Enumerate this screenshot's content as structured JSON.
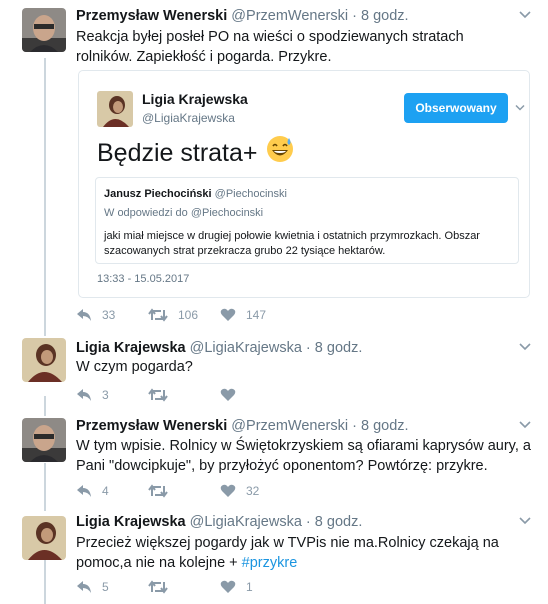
{
  "tweets": [
    {
      "name": "Przemysław Wenerski",
      "handle": "@PrzemWenerski",
      "separator": "·",
      "time": "8 godz.",
      "text": "Reakcja byłej posłeł PO na wieści o spodziewanych stratach rolników. Zapiekłość i pogarda. Przykre.",
      "reply_count": "33",
      "retweet_count": "106",
      "like_count": "147"
    },
    {
      "name": "Ligia Krajewska",
      "handle": "@LigiaKrajewska",
      "separator": "·",
      "time": "8 godz.",
      "text": "W czym pogarda?",
      "reply_count": "3",
      "retweet_count": "",
      "like_count": ""
    },
    {
      "name": "Przemysław Wenerski",
      "handle": "@PrzemWenerski",
      "separator": "·",
      "time": "8 godz.",
      "text": "W tym wpisie. Rolnicy w Świętokrzyskiem są ofiarami kaprysów aury, a Pani \"dowcipkuje\", by przyłożyć oponentom? Powtórzę: przykre.",
      "reply_count": "4",
      "retweet_count": "",
      "like_count": "32"
    },
    {
      "name": "Ligia Krajewska",
      "handle": "@LigiaKrajewska",
      "separator": "·",
      "time": "8 godz.",
      "text": "Przecież większej pogardy jak w TVPis nie ma.Rolnicy czekają na pomoc,a nie na kolejne + ",
      "hashtag": "#przykre",
      "reply_count": "5",
      "retweet_count": "",
      "like_count": "1"
    }
  ],
  "quoted": {
    "name": "Ligia Krajewska",
    "handle": "@LigiaKrajewska",
    "follow_label": "Obserwowany",
    "text": "Będzie strata+",
    "emoji": "😅",
    "time": "13:33 - 15.05.2017",
    "inner": {
      "name": "Janusz Piechociński",
      "handle": "@Piechocinski",
      "reply_to": "W odpowiedzi do @Piechocinski",
      "text": "jaki miał miejsce w drugiej połowie kwietnia i ostatnich przymrozkach. Obszar szacowanych strat przekracza grubo 22 tysiące hektarów."
    }
  },
  "colors": {
    "link": "#1b95e0",
    "follow_button": "#1da1f2",
    "thread_line": "#ccd6dd",
    "muted": "#657786",
    "action_icon": "#8a9aa8"
  },
  "icons": [
    "reply-icon",
    "retweet-icon",
    "like-icon",
    "chevron-down-icon"
  ]
}
